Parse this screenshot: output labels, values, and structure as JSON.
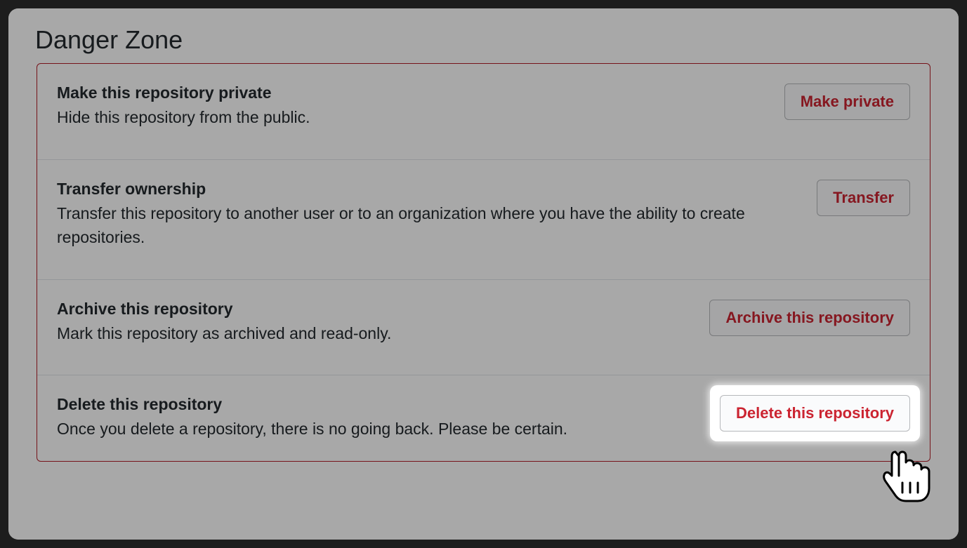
{
  "section": {
    "title": "Danger Zone"
  },
  "items": [
    {
      "title": "Make this repository private",
      "description": "Hide this repository from the public.",
      "button": "Make private"
    },
    {
      "title": "Transfer ownership",
      "description": "Transfer this repository to another user or to an organization where you have the ability to create repositories.",
      "button": "Transfer"
    },
    {
      "title": "Archive this repository",
      "description": "Mark this repository as archived and read-only.",
      "button": "Archive this repository"
    },
    {
      "title": "Delete this repository",
      "description": "Once you delete a repository, there is no going back. Please be certain.",
      "button": "Delete this repository"
    }
  ]
}
